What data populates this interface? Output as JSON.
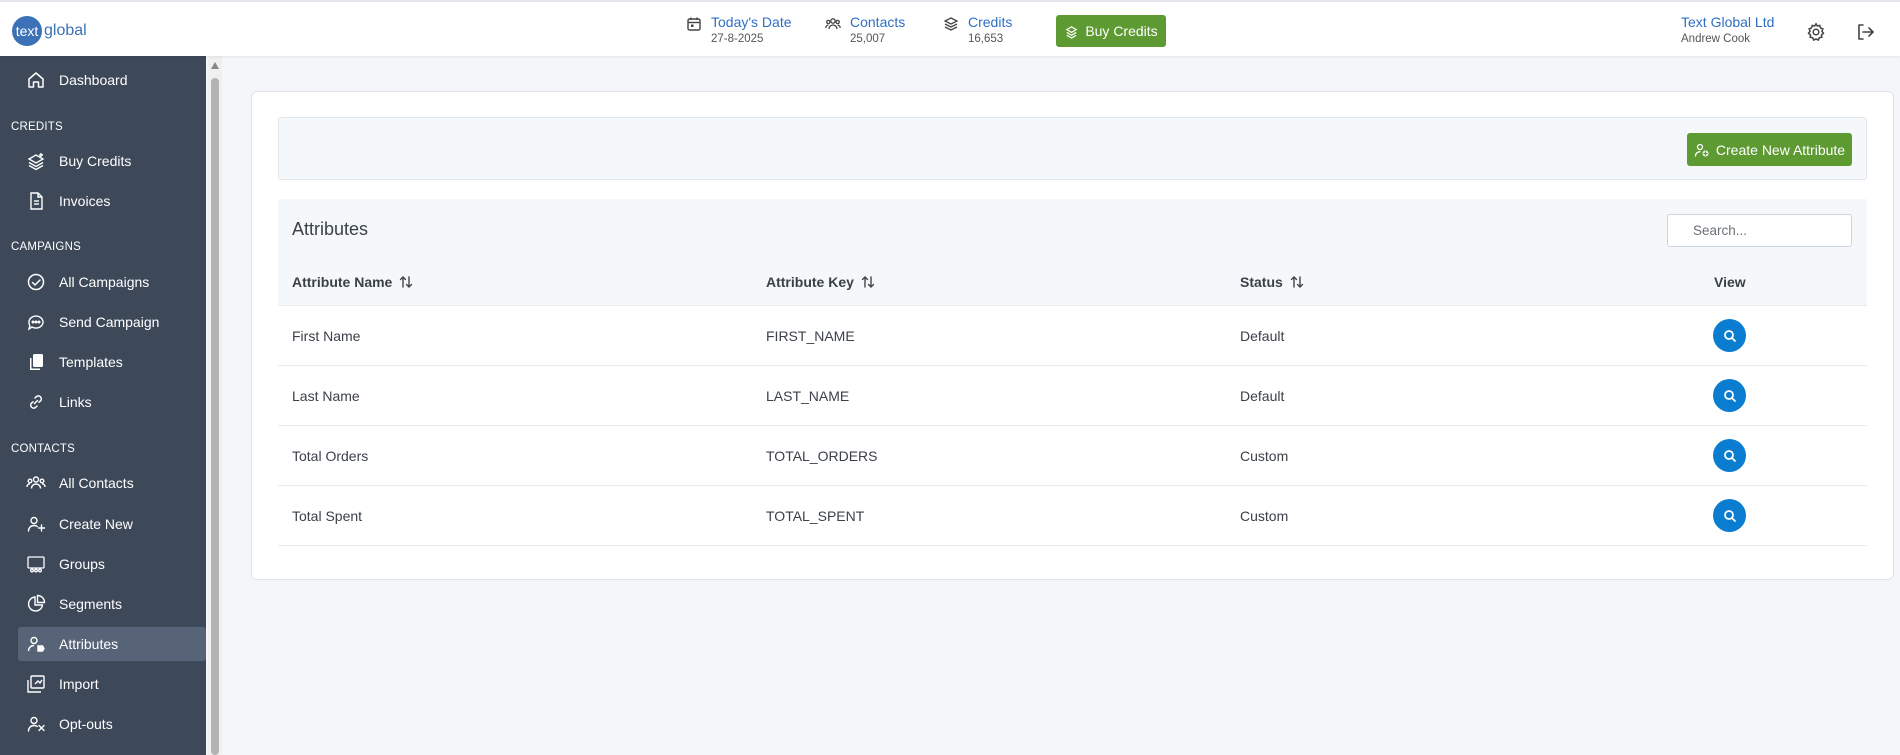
{
  "header": {
    "logo": {
      "mark": "text",
      "word": "global"
    },
    "date": {
      "label": "Today's Date",
      "value": "27-8-2025"
    },
    "contacts": {
      "label": "Contacts",
      "value": "25,007"
    },
    "credits": {
      "label": "Credits",
      "value": "16,653"
    },
    "buy_credits_label": "Buy Credits",
    "company_name": "Text Global Ltd",
    "user_name": "Andrew Cook",
    "icons": [
      "calendar-icon",
      "contacts-icon",
      "credits-stack-icon",
      "gear-icon",
      "logout-icon"
    ]
  },
  "sidebar": {
    "dashboard": "Dashboard",
    "sections": {
      "credits": "CREDITS",
      "campaigns": "CAMPAIGNS",
      "contacts": "CONTACTS"
    },
    "items": {
      "buy_credits": "Buy Credits",
      "invoices": "Invoices",
      "all_campaigns": "All Campaigns",
      "send_campaign": "Send Campaign",
      "templates": "Templates",
      "links": "Links",
      "all_contacts": "All Contacts",
      "create_new": "Create New",
      "groups": "Groups",
      "segments": "Segments",
      "attributes": "Attributes",
      "import": "Import",
      "opt_outs": "Opt-outs"
    },
    "active": "attributes"
  },
  "main": {
    "create_button_label": "Create New Attribute",
    "table_title": "Attributes",
    "search_placeholder": "Search...",
    "columns": [
      "Attribute Name",
      "Attribute Key",
      "Status",
      "View"
    ],
    "rows": [
      {
        "name": "First Name",
        "key": "FIRST_NAME",
        "status": "Default"
      },
      {
        "name": "Last Name",
        "key": "LAST_NAME",
        "status": "Default"
      },
      {
        "name": "Total Orders",
        "key": "TOTAL_ORDERS",
        "status": "Custom"
      },
      {
        "name": "Total Spent",
        "key": "TOTAL_SPENT",
        "status": "Custom"
      }
    ]
  },
  "colors": {
    "sidebar_bg": "#3d4858",
    "sidebar_active": "#576377",
    "accent_green": "#5d9a31",
    "link_blue": "#2f6fc4",
    "view_button_blue": "#0b7dd0"
  }
}
